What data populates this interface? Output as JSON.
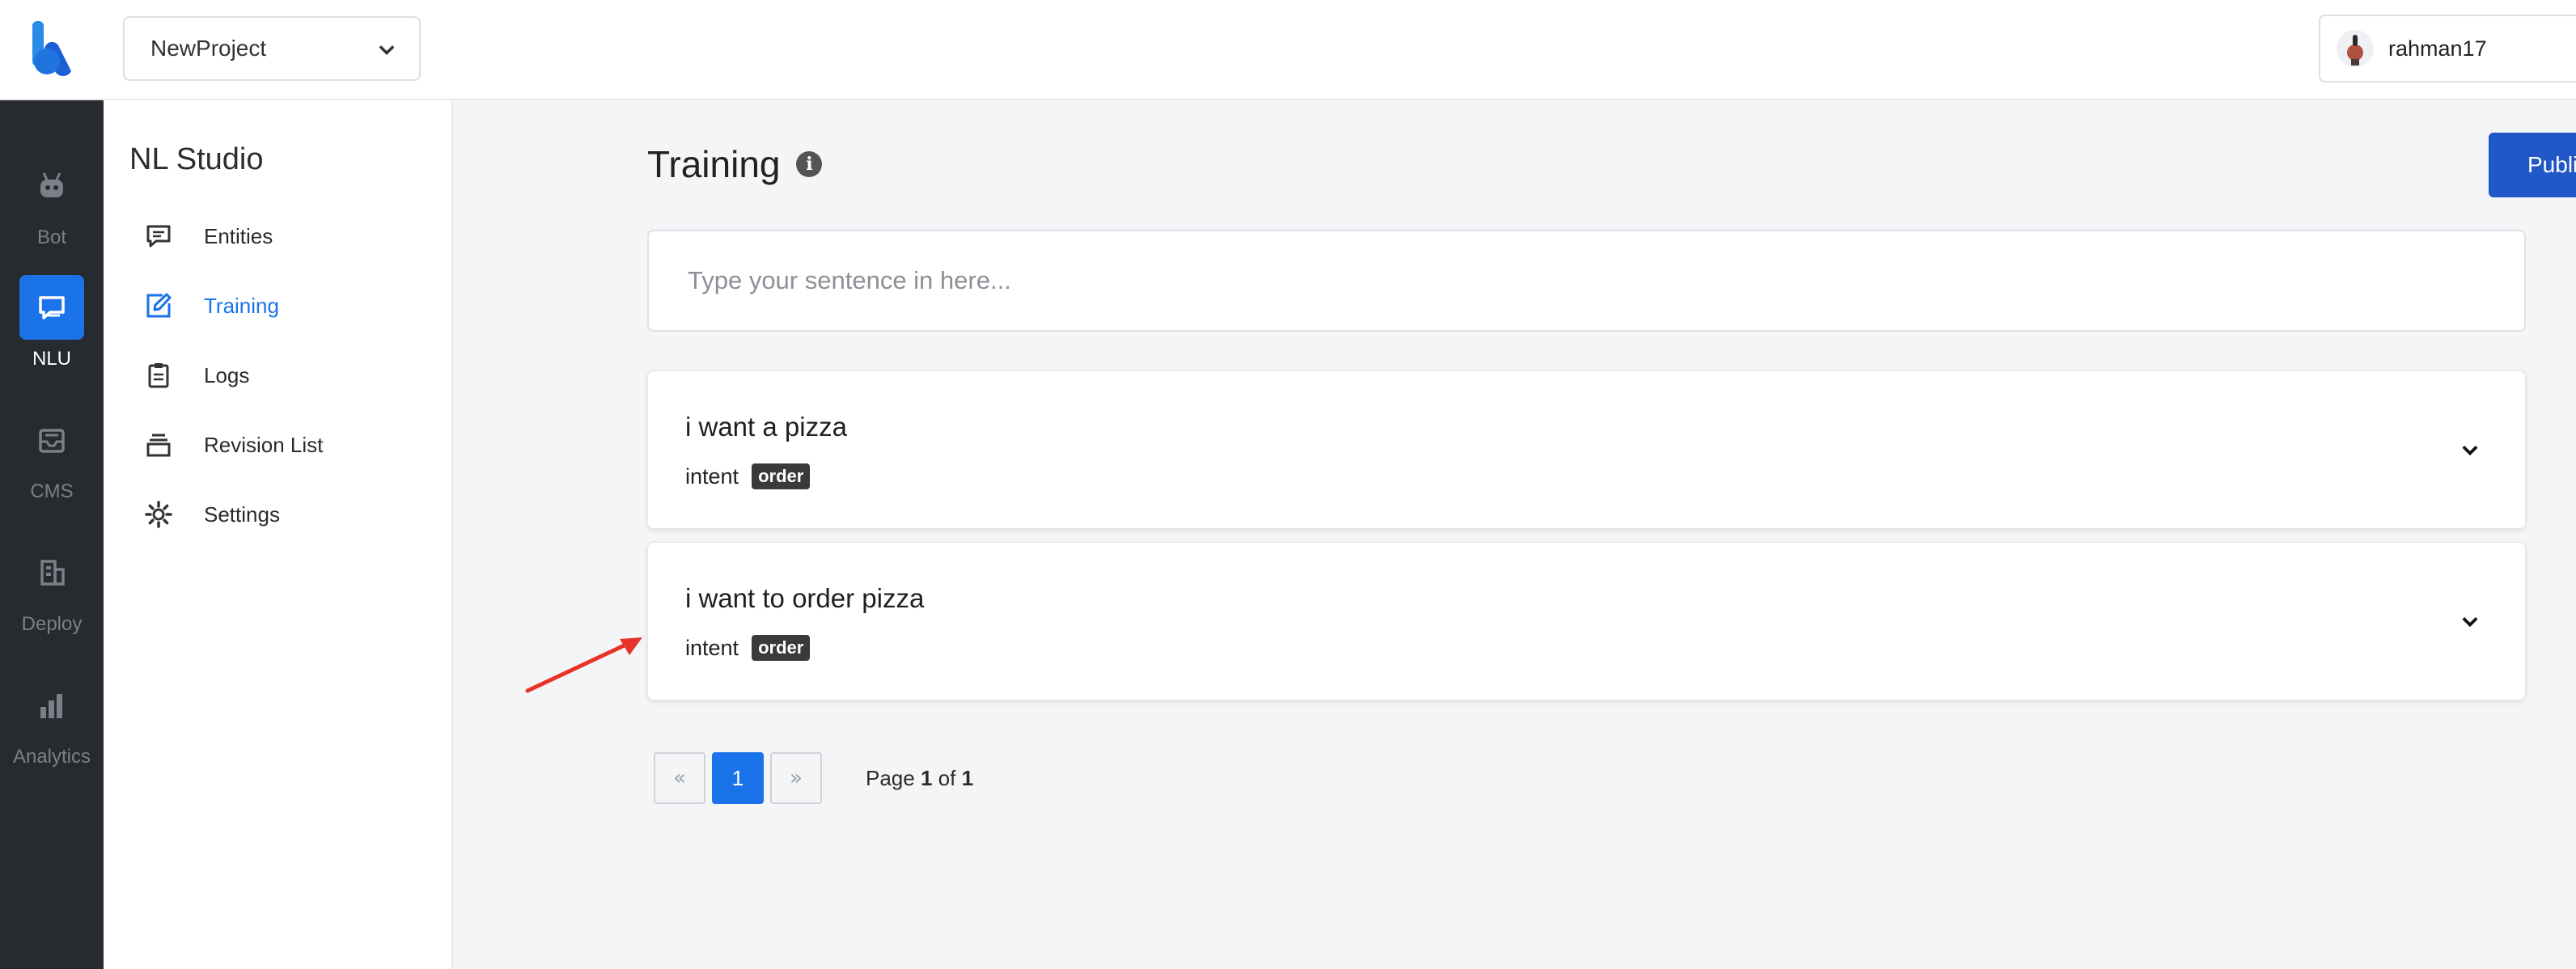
{
  "header": {
    "project_name": "NewProject",
    "username": "rahman17"
  },
  "rail": {
    "items": [
      {
        "label": "Bot",
        "icon": "robot-icon"
      },
      {
        "label": "NLU",
        "icon": "chat-bubble-icon"
      },
      {
        "label": "CMS",
        "icon": "inbox-icon"
      },
      {
        "label": "Deploy",
        "icon": "building-icon"
      },
      {
        "label": "Analytics",
        "icon": "bar-chart-icon"
      }
    ],
    "active": "NLU"
  },
  "sidebar": {
    "title": "NL Studio",
    "items": [
      {
        "label": "Entities",
        "icon": "comment-icon"
      },
      {
        "label": "Training",
        "icon": "edit-icon"
      },
      {
        "label": "Logs",
        "icon": "clipboard-icon"
      },
      {
        "label": "Revision List",
        "icon": "layers-icon"
      },
      {
        "label": "Settings",
        "icon": "gear-icon"
      }
    ],
    "active": "Training"
  },
  "main": {
    "title": "Training",
    "publish_label": "Publish",
    "input_placeholder": "Type your sentence in here...",
    "samples": [
      {
        "text": "i want a pizza",
        "label": "intent",
        "intent": "order"
      },
      {
        "text": "i want to order pizza",
        "label": "intent",
        "intent": "order"
      }
    ],
    "pagination": {
      "prev": "«",
      "current": "1",
      "next": "»",
      "info_prefix": "Page",
      "info_page": "1",
      "info_of": "of",
      "info_total": "1"
    }
  },
  "colors": {
    "accent": "#1a73e8",
    "publish": "#2157c7",
    "rail_bg": "#272a2e",
    "annotation_arrow": "#e8322a"
  }
}
